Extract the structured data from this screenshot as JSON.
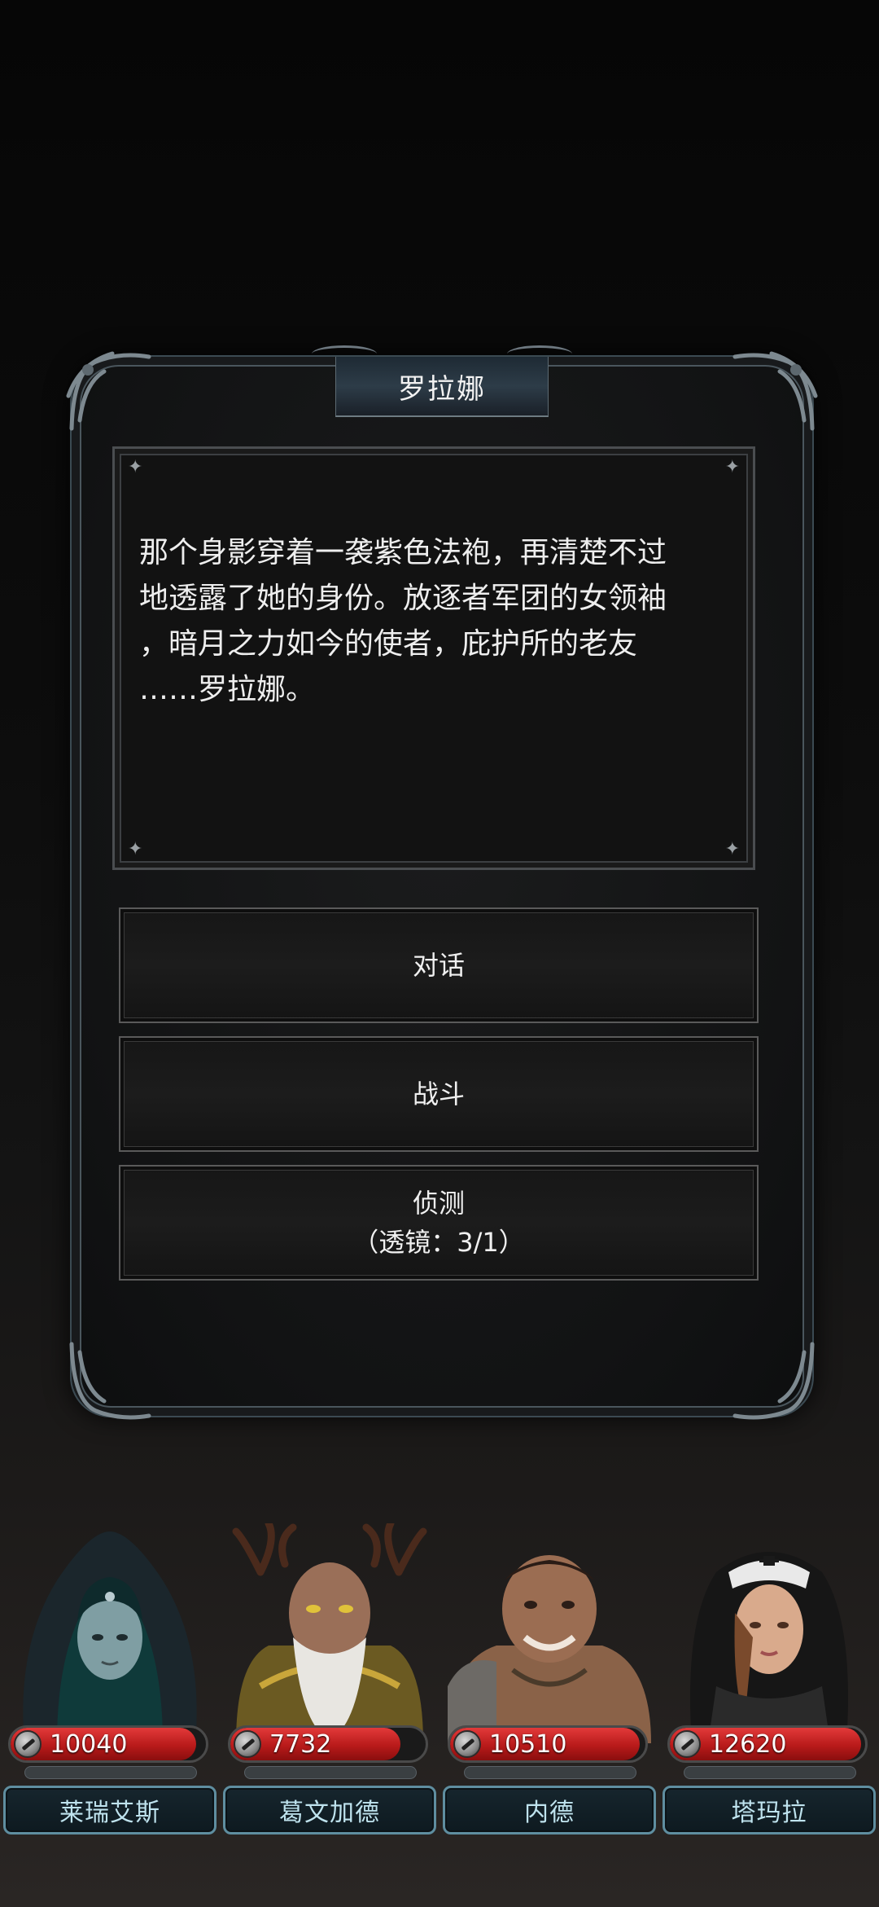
{
  "dialog": {
    "title": "罗拉娜",
    "narrative": "那个身影穿着一袭紫色法袍，再清楚不过\n地透露了她的身份。放逐者军团的女领袖\n，暗月之力如今的使者，庇护所的老友\n……罗拉娜。",
    "options": [
      {
        "label": "对话"
      },
      {
        "label": "战斗"
      },
      {
        "label": "侦测",
        "sub": "（透镜：3/1）"
      }
    ]
  },
  "party": [
    {
      "name": "莱瑞艾斯",
      "hp": "10040",
      "hp_fill": 0.95
    },
    {
      "name": "葛文加德",
      "hp": "7732",
      "hp_fill": 0.87
    },
    {
      "name": "内德",
      "hp": "10510",
      "hp_fill": 0.97
    },
    {
      "name": "塔玛拉",
      "hp": "12620",
      "hp_fill": 0.98
    }
  ],
  "colors": {
    "hp_red": "#c42020",
    "name_border": "#5f8ea0",
    "name_text": "#bfe3ee"
  },
  "icons": [
    "hp-sword-icon",
    "corner-ornament-icon",
    "sparkle-icon"
  ]
}
